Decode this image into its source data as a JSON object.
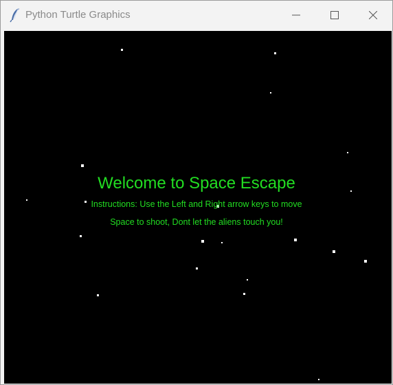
{
  "window": {
    "title": "Python Turtle Graphics",
    "app_icon": "feather-icon",
    "controls": [
      "minimize-icon",
      "maximize-icon",
      "close-icon"
    ]
  },
  "game": {
    "welcome": "Welcome to Space Escape",
    "instructions_line1": "Instructions: Use the Left and Right arrow keys to move",
    "instructions_line2": "Space to shoot, Dont let the aliens touch you!",
    "text_color": "#22dd22",
    "background_color": "#000000",
    "star_color": "#ffffff"
  }
}
